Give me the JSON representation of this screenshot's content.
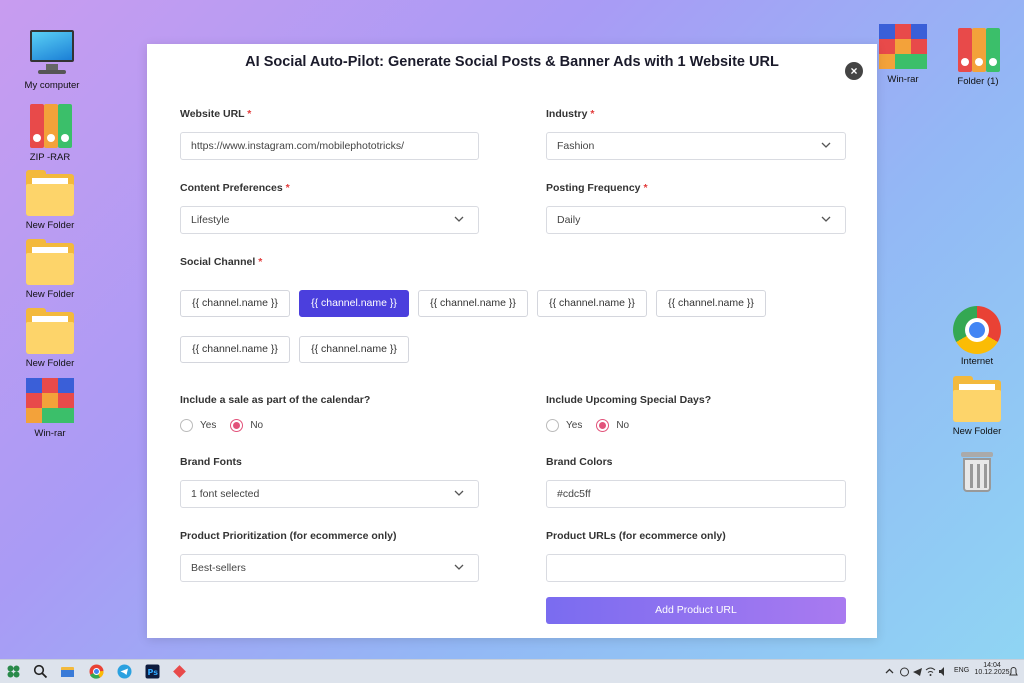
{
  "desktop_left": [
    {
      "label": "My computer",
      "icon": "computer-icon"
    },
    {
      "label": "ZIP -RAR",
      "icon": "zip-rar-icon"
    },
    {
      "label": "New Folder",
      "icon": "folder-icon"
    },
    {
      "label": "New Folder",
      "icon": "folder-icon"
    },
    {
      "label": "New Folder",
      "icon": "folder-icon"
    },
    {
      "label": "Win-rar",
      "icon": "winrar-icon"
    }
  ],
  "desktop_right": [
    {
      "label": "Win-rar",
      "icon": "winrar-icon"
    },
    {
      "label": "Folder (1)",
      "icon": "zip-rar-icon"
    },
    {
      "label": "Internet",
      "icon": "chrome-icon"
    },
    {
      "label": "New Folder",
      "icon": "folder-icon"
    },
    {
      "label": "",
      "icon": "trash-icon"
    }
  ],
  "modal": {
    "title": "AI Social Auto-Pilot: Generate Social Posts & Banner Ads with 1 Website URL",
    "close": "×",
    "website_url": {
      "label": "Website URL",
      "value": "https://www.instagram.com/mobilephototricks/"
    },
    "industry": {
      "label": "Industry",
      "value": "Fashion"
    },
    "content_preferences": {
      "label": "Content Preferences",
      "value": "Lifestyle"
    },
    "posting_frequency": {
      "label": "Posting Frequency",
      "value": "Daily"
    },
    "social_channel": {
      "label": "Social Channel",
      "chips": [
        "{{ channel.name }}",
        "{{ channel.name }}",
        "{{ channel.name }}",
        "{{ channel.name }}",
        "{{ channel.name }}",
        "{{ channel.name }}",
        "{{ channel.name }}"
      ],
      "active_index": 1
    },
    "include_sale": {
      "label": "Include a sale as part of the calendar?",
      "yes": "Yes",
      "no": "No",
      "selected": "No"
    },
    "special_days": {
      "label": "Include Upcoming Special Days?",
      "yes": "Yes",
      "no": "No",
      "selected": "No"
    },
    "brand_fonts": {
      "label": "Brand Fonts",
      "value": "1 font selected"
    },
    "brand_colors": {
      "label": "Brand Colors",
      "value": "#cdc5ff"
    },
    "product_prioritization": {
      "label": "Product Prioritization (for ecommerce only)",
      "value": "Best-sellers"
    },
    "product_urls": {
      "label": "Product URLs (for ecommerce only)",
      "value": ""
    },
    "add_product_url": "Add Product URL",
    "required_mark": "*"
  },
  "taskbar": {
    "tray_lang": "ENG",
    "time": "14:04",
    "date": "10.12.2025"
  },
  "colors": {
    "accent": "#4b3fdd",
    "radio": "#e2527a",
    "button_start": "#7a6cf0",
    "button_end": "#a97af0"
  }
}
